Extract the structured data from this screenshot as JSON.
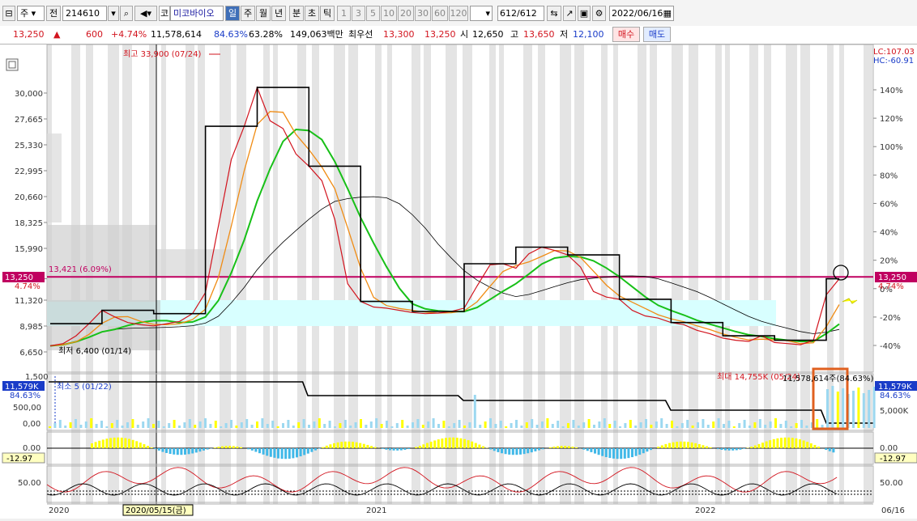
{
  "toolbar": {
    "market_select": "주",
    "prev_label": "전",
    "stock_code": "214610",
    "market_badge": "코",
    "stock_name": "미코바이오",
    "periods": [
      "일",
      "주",
      "월",
      "년",
      "분",
      "초",
      "틱"
    ],
    "selected_period": "일",
    "intervals": [
      "1",
      "3",
      "5",
      "10",
      "20",
      "30",
      "60",
      "120"
    ],
    "count_current": "612",
    "count_total": "/612",
    "date": "2022/06/16"
  },
  "quote": {
    "price": "13,250",
    "change_arrow": "▲",
    "change": "600",
    "change_pct": "+4.74%",
    "volume": "11,578,614",
    "volume_ratio": "84.63%",
    "turnover": "63.28%",
    "amount": "149,063백만",
    "best_label": "최우선",
    "ask": "13,300",
    "bid": "13,250",
    "open_label": "시",
    "open": "12,650",
    "high_label": "고",
    "high": "13,650",
    "low_label": "저",
    "low": "12,100",
    "buy_label": "매수",
    "sell_label": "매도"
  },
  "chart_data": {
    "type": "line",
    "price_axis_ticks": [
      "30,000",
      "27,665",
      "25,330",
      "22,995",
      "20,660",
      "18,325",
      "15,990",
      "13,250",
      "11,320",
      "8,985",
      "6,650"
    ],
    "pct_axis_ticks": [
      "140%",
      "120%",
      "100%",
      "80%",
      "60%",
      "40%",
      "20%",
      "0%",
      "-20%",
      "-40%"
    ],
    "current_price": "13,250",
    "current_pct": "4.74%",
    "lc_label": "LC:107.03",
    "hc_label": "HC:-60.91",
    "high_annotation": "최고 33,900 (07/24)",
    "low_annotation": "최저 6,400 (01/14)",
    "hline_annotation": "13,421 (6.09%)",
    "hline_price": 13421,
    "x_ticks": [
      "2020",
      "2021",
      "2022",
      "06/16"
    ],
    "crosshair_date": "2020/05/15(금)",
    "close_series": [
      7200,
      7400,
      8100,
      9200,
      10400,
      9800,
      9300,
      9100,
      9000,
      9200,
      9400,
      10100,
      12000,
      18000,
      24000,
      27000,
      30500,
      27500,
      26800,
      24500,
      23400,
      22100,
      18600,
      12800,
      11200,
      10700,
      10600,
      10400,
      10200,
      10100,
      10150,
      10300,
      10600,
      12600,
      14500,
      14600,
      14200,
      15500,
      16100,
      15800,
      15400,
      14300,
      12100,
      11600,
      11400,
      10400,
      9900,
      9700,
      9300,
      9100,
      8600,
      8300,
      7900,
      7700,
      7600,
      8100,
      7500,
      7400,
      7300,
      7700,
      11800,
      13250
    ],
    "volume_panel": {
      "ticks": [
        "1,500",
        "500,00",
        "0,00"
      ],
      "right_label": "11,579K",
      "right_pct": "84.63%",
      "right_tick": "5,000K",
      "min_annotation": "최소 5 (01/22)",
      "max_annotation": "최대 14,755K (05/24)",
      "current_annotation": "11,578,614주(84.63%)"
    },
    "osc_panel": {
      "ticks": [
        "0.00"
      ],
      "value": "-12.97"
    },
    "rsi_panel": {
      "ticks": [
        "50.00"
      ]
    }
  },
  "colors": {
    "up": "#d2141e",
    "down": "#1a3cc8",
    "hline": "#c00060",
    "cloud": "#d8ffff"
  }
}
